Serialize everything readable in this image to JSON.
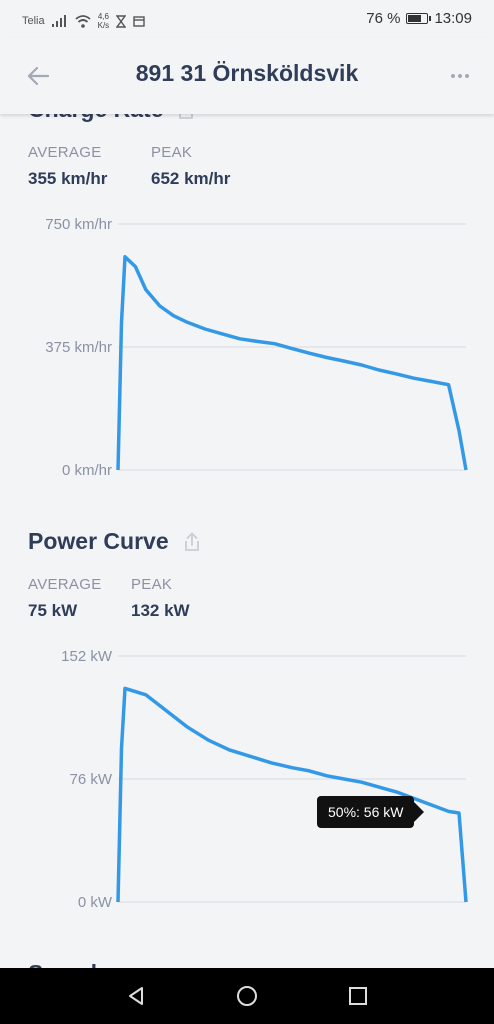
{
  "status_bar": {
    "carrier": "Telia",
    "net_speed_value": "4,6",
    "net_speed_unit": "K/s",
    "battery_percent": "76 %",
    "battery_level": 0.76,
    "time": "13:09"
  },
  "header": {
    "title": "891 31 Örnsköldsvik",
    "back_icon": "arrow-left-icon",
    "more_icon": "more-horizontal-icon"
  },
  "charge_rate": {
    "title": "Charge Rate",
    "average_label": "AVERAGE",
    "average_value": "355 km/hr",
    "peak_label": "PEAK",
    "peak_value": "652 km/hr"
  },
  "power_curve": {
    "title": "Power Curve",
    "average_label": "AVERAGE",
    "average_value": "75 kW",
    "peak_label": "PEAK",
    "peak_value": "132 kW",
    "tooltip": "50%: 56 kW"
  },
  "next_section": {
    "title": "Speed"
  },
  "colors": {
    "accent": "#3399e6",
    "text": "#2f3d59",
    "muted": "#8a92a3"
  },
  "chart_data": [
    {
      "type": "line",
      "title": "Charge Rate",
      "ylabel": "",
      "y_ticks": [
        "750 km/hr",
        "375 km/hr",
        "0 km/hr"
      ],
      "ylim": [
        0,
        750
      ],
      "grid": true,
      "series": [
        {
          "x": [
            0,
            1,
            2,
            5,
            8,
            12,
            16,
            20,
            25,
            30,
            35,
            40,
            45,
            50,
            55,
            60,
            65,
            70,
            75,
            80,
            85,
            90,
            95,
            98,
            100
          ],
          "values": [
            0,
            450,
            650,
            620,
            550,
            500,
            470,
            450,
            430,
            415,
            400,
            392,
            385,
            370,
            356,
            343,
            332,
            320,
            305,
            293,
            280,
            270,
            260,
            120,
            0
          ]
        }
      ]
    },
    {
      "type": "line",
      "title": "Power Curve",
      "ylabel": "",
      "y_ticks": [
        "152 kW",
        "76 kW",
        "0 kW"
      ],
      "ylim": [
        0,
        152
      ],
      "grid": true,
      "series": [
        {
          "x": [
            0,
            1,
            2,
            8,
            14,
            20,
            26,
            32,
            38,
            44,
            50,
            55,
            60,
            65,
            70,
            75,
            80,
            85,
            90,
            95,
            98,
            100
          ],
          "values": [
            0,
            95,
            132,
            128,
            118,
            108,
            100,
            94,
            90,
            86,
            83,
            81,
            78,
            76,
            74,
            71,
            68,
            64,
            60,
            56,
            55,
            0
          ]
        }
      ]
    }
  ]
}
